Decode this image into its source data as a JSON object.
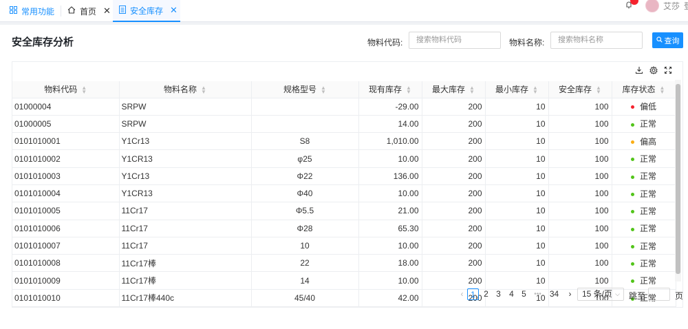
{
  "tabs": [
    {
      "label": "常用功能",
      "icon": "grid-icon"
    },
    {
      "label": "首页",
      "icon": "home-icon"
    },
    {
      "label": "安全库存",
      "icon": "document-icon"
    }
  ],
  "user": {
    "name": "艾莎",
    "extra": "登"
  },
  "page_title": "安全库存分析",
  "filters": {
    "code_label": "物料代码:",
    "code_placeholder": "搜索物料代码",
    "name_label": "物料名称:",
    "name_placeholder": "搜索物料名称",
    "search_button": "查询"
  },
  "table": {
    "columns": [
      "物料代码",
      "物料名称",
      "规格型号",
      "现有库存",
      "最大库存",
      "最小库存",
      "安全库存",
      "库存状态"
    ],
    "rows": [
      {
        "code": "01000004",
        "name": "SRPW",
        "spec": "",
        "stock": "-29.00",
        "max": "200",
        "min": "10",
        "safe": "100",
        "status": "偏低",
        "status_color": "#f5222d"
      },
      {
        "code": "01000005",
        "name": "SRPW",
        "spec": "",
        "stock": "14.00",
        "max": "200",
        "min": "10",
        "safe": "100",
        "status": "正常",
        "status_color": "#52c41a"
      },
      {
        "code": "0101010001",
        "name": "Y1Cr13",
        "spec": "S8",
        "stock": "1,010.00",
        "max": "200",
        "min": "10",
        "safe": "100",
        "status": "偏高",
        "status_color": "#faad14"
      },
      {
        "code": "0101010002",
        "name": "Y1CR13",
        "spec": "φ25",
        "stock": "10.00",
        "max": "200",
        "min": "10",
        "safe": "100",
        "status": "正常",
        "status_color": "#52c41a"
      },
      {
        "code": "0101010003",
        "name": "Y1Cr13",
        "spec": "Φ22",
        "stock": "136.00",
        "max": "200",
        "min": "10",
        "safe": "100",
        "status": "正常",
        "status_color": "#52c41a"
      },
      {
        "code": "0101010004",
        "name": "Y1CR13",
        "spec": "Φ40",
        "stock": "10.00",
        "max": "200",
        "min": "10",
        "safe": "100",
        "status": "正常",
        "status_color": "#52c41a"
      },
      {
        "code": "0101010005",
        "name": "11Cr17",
        "spec": "Φ5.5",
        "stock": "21.00",
        "max": "200",
        "min": "10",
        "safe": "100",
        "status": "正常",
        "status_color": "#52c41a"
      },
      {
        "code": "0101010006",
        "name": "11Cr17",
        "spec": "Φ28",
        "stock": "65.30",
        "max": "200",
        "min": "10",
        "safe": "100",
        "status": "正常",
        "status_color": "#52c41a"
      },
      {
        "code": "0101010007",
        "name": "11Cr17",
        "spec": "10",
        "stock": "10.00",
        "max": "200",
        "min": "10",
        "safe": "100",
        "status": "正常",
        "status_color": "#52c41a"
      },
      {
        "code": "0101010008",
        "name": "11Cr17棒",
        "spec": "22",
        "stock": "18.00",
        "max": "200",
        "min": "10",
        "safe": "100",
        "status": "正常",
        "status_color": "#52c41a"
      },
      {
        "code": "0101010009",
        "name": "11Cr17棒",
        "spec": "14",
        "stock": "10.00",
        "max": "200",
        "min": "10",
        "safe": "100",
        "status": "正常",
        "status_color": "#52c41a"
      },
      {
        "code": "0101010010",
        "name": "11Cr17棒440c",
        "spec": "45/40",
        "stock": "42.00",
        "max": "200",
        "min": "10",
        "safe": "100",
        "status": "正常",
        "status_color": "#52c41a"
      }
    ]
  },
  "pagination": {
    "pages": [
      "1",
      "2",
      "3",
      "4",
      "5"
    ],
    "ellipsis": "•••",
    "last_page": "34",
    "current": "1",
    "page_size": "15 条/页",
    "jump_label": "跳至",
    "page_suffix": "页"
  }
}
